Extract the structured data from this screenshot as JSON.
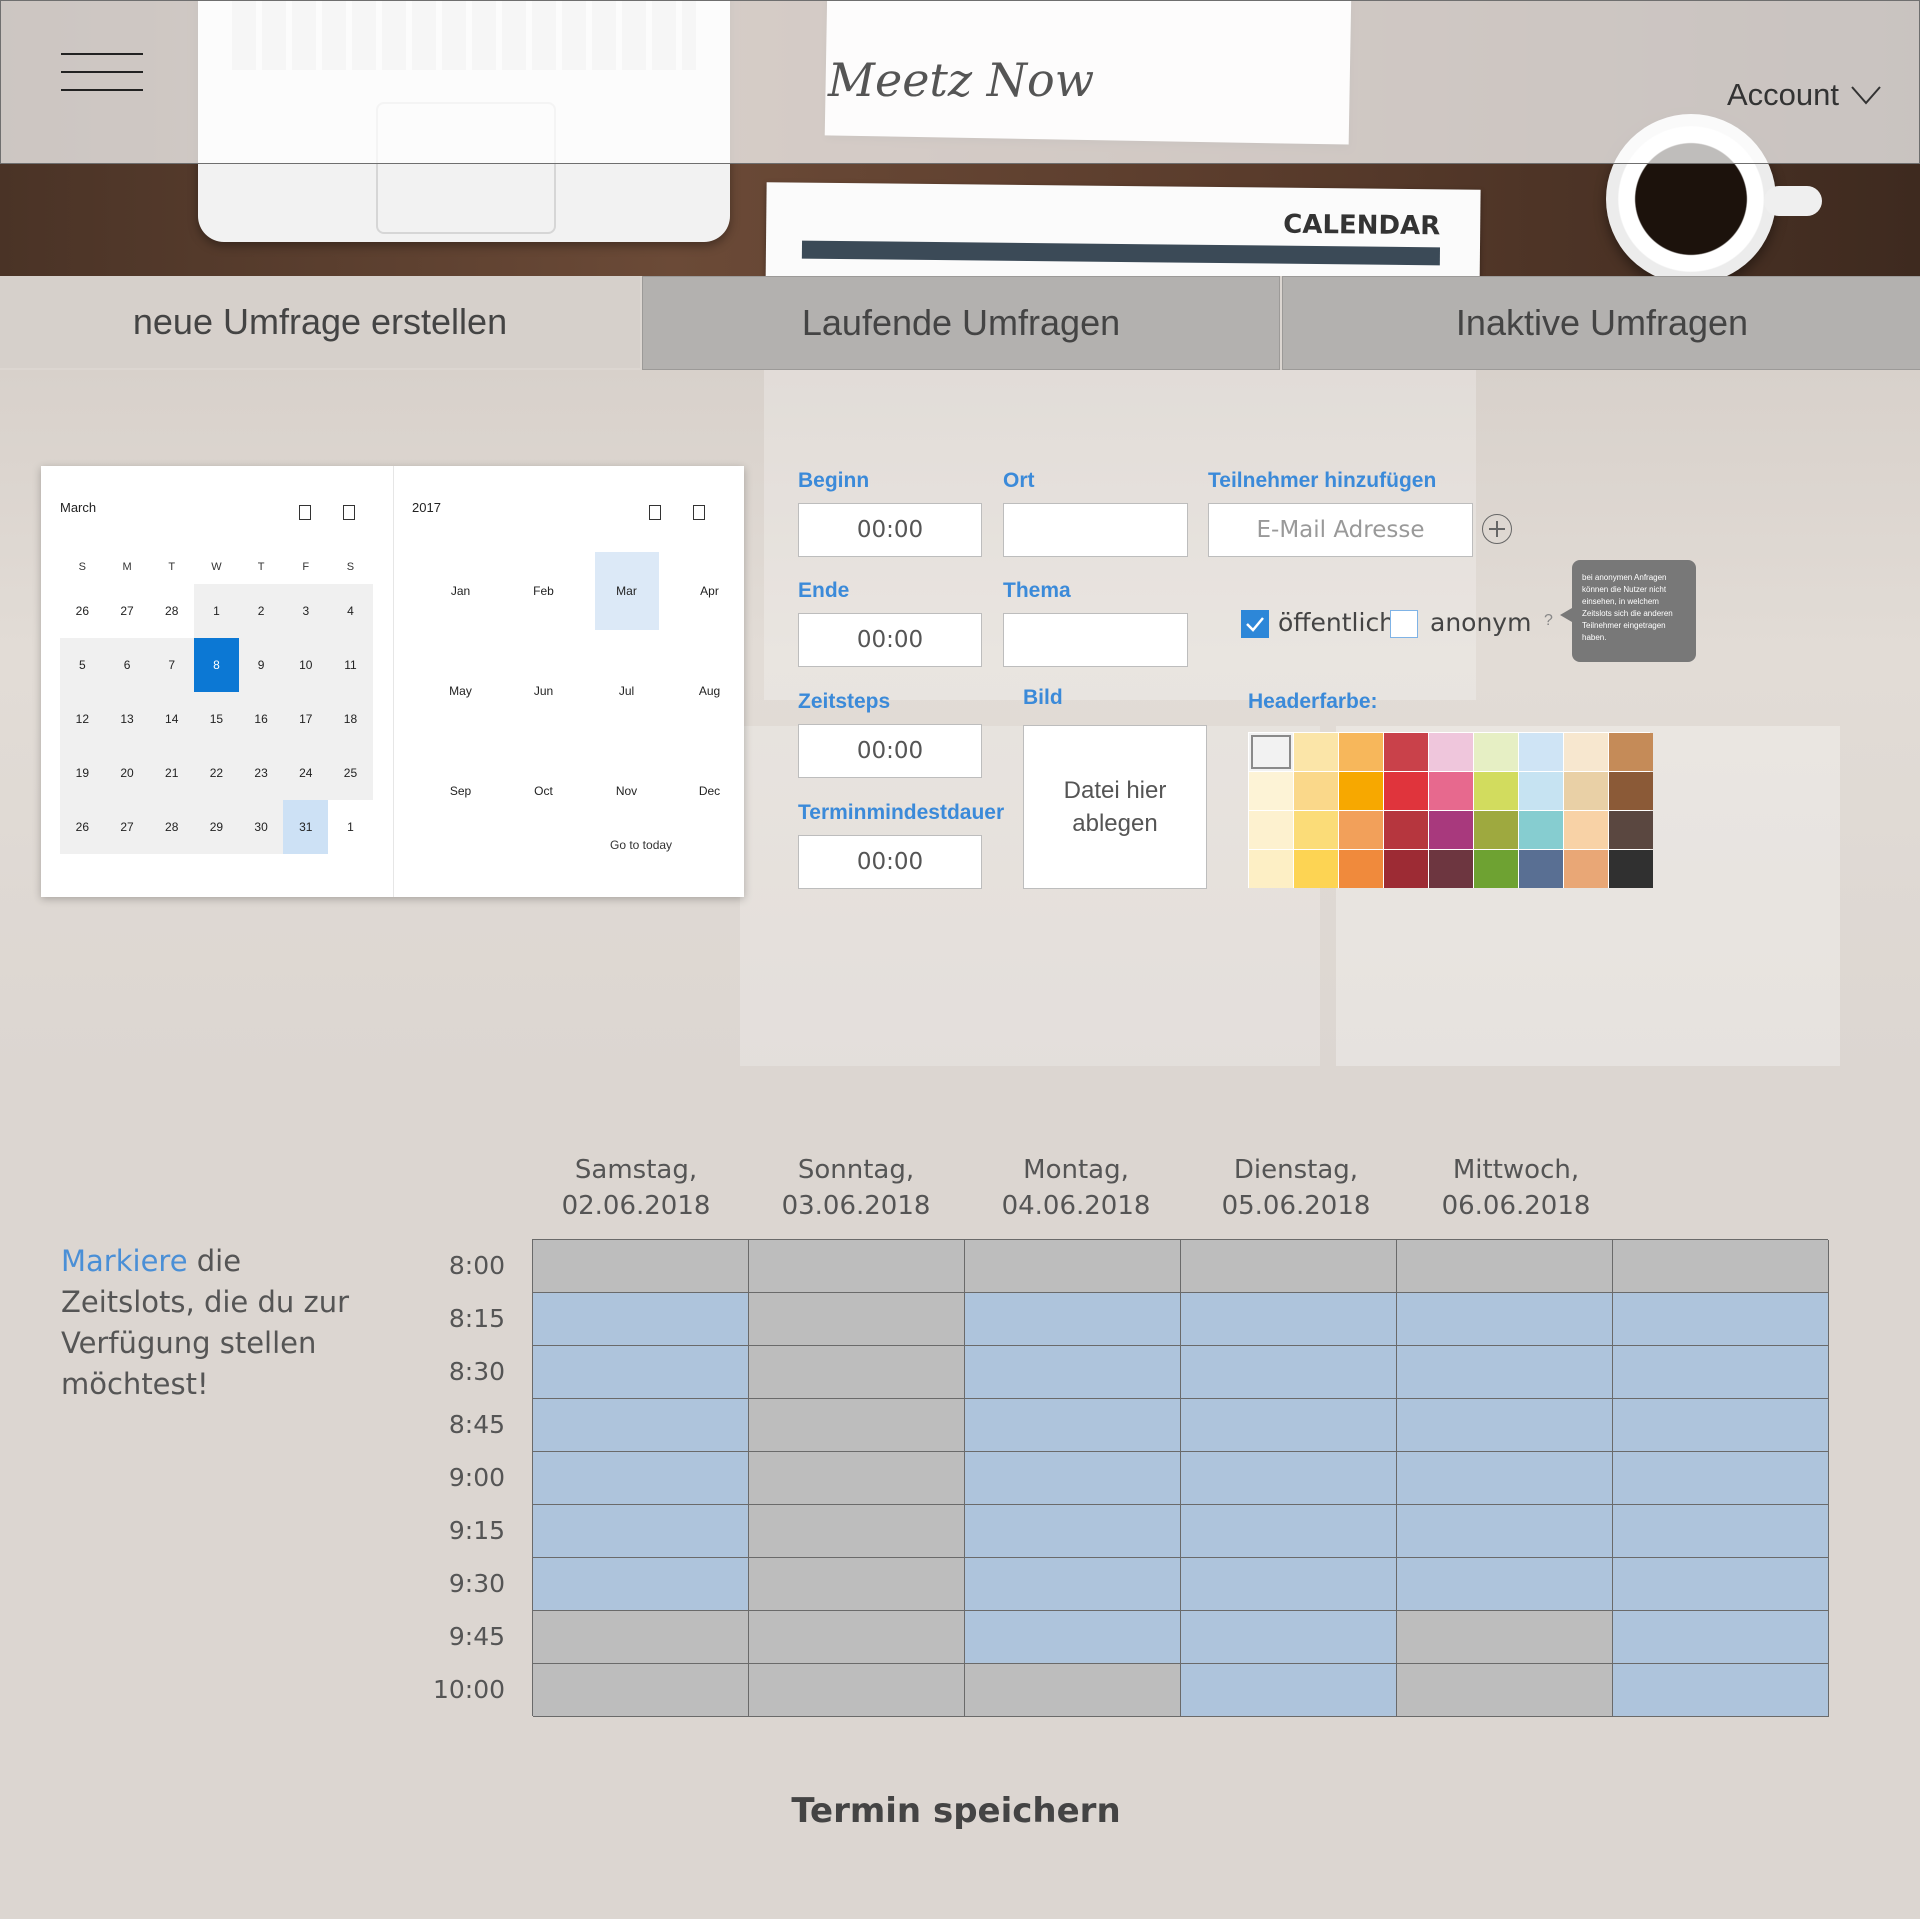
{
  "header": {
    "logo": "Meetz Now",
    "account_label": "Account",
    "menu_icon": "hamburger-icon",
    "account_icon": "chevron-down-icon",
    "background_text": "CALENDAR"
  },
  "tabs": [
    {
      "label": "neue Umfrage erstellen",
      "active": true
    },
    {
      "label": "Laufende Umfragen",
      "active": false
    },
    {
      "label": "Inaktive Umfragen",
      "active": false
    }
  ],
  "datepicker": {
    "month_label": "March",
    "year_label": "2017",
    "weekdays": [
      "S",
      "M",
      "T",
      "W",
      "T",
      "F",
      "S"
    ],
    "weeks": [
      [
        "26",
        "27",
        "28",
        "1",
        "2",
        "3",
        "4"
      ],
      [
        "5",
        "6",
        "7",
        "8",
        "9",
        "10",
        "11"
      ],
      [
        "12",
        "13",
        "14",
        "15",
        "16",
        "17",
        "18"
      ],
      [
        "19",
        "20",
        "21",
        "22",
        "23",
        "24",
        "25"
      ],
      [
        "26",
        "27",
        "28",
        "29",
        "30",
        "31",
        "1"
      ]
    ],
    "selected_day": "8",
    "months": [
      "Jan",
      "Feb",
      "Mar",
      "Apr",
      "May",
      "Jun",
      "Jul",
      "Aug",
      "Sep",
      "Oct",
      "Nov",
      "Dec"
    ],
    "current_month": "Mar",
    "go_to_today": "Go to today"
  },
  "form": {
    "beginn": {
      "label": "Beginn",
      "value": "00:00"
    },
    "ende": {
      "label": "Ende",
      "value": "00:00"
    },
    "zeitsteps": {
      "label": "Zeitsteps",
      "value": "00:00"
    },
    "terminmindestdauer": {
      "label": "Terminmindestdauer",
      "value": "00:00"
    },
    "ort": {
      "label": "Ort",
      "value": ""
    },
    "thema": {
      "label": "Thema",
      "value": ""
    },
    "bild": {
      "label": "Bild",
      "dropzone_text": "Datei hier ablegen"
    },
    "teilnehmer": {
      "label": "Teilnehmer hinzufügen",
      "placeholder": "E-Mail Adresse"
    },
    "oeffentlich": {
      "label": "öffentlich",
      "checked": true
    },
    "anonym": {
      "label": "anonym",
      "checked": false
    },
    "help": "?",
    "tooltip": "bei anonymen Anfragen können die Nutzer nicht einsehen, in welchem Zeitslots sich die anderen Teilnehmer eingetragen haben.",
    "headerfarbe_label": "Headerfarbe:",
    "palette": [
      [
        "#f2f2f2",
        "#fbe5a8",
        "#f7b75b",
        "#c9414a",
        "#efc6dc",
        "#e6efc4",
        "#cfe4f5",
        "#f7e7cf",
        "#c58b58"
      ],
      [
        "#fdf3d6",
        "#fad88a",
        "#f7a800",
        "#e0343c",
        "#e7698e",
        "#d2dc5e",
        "#c6e3f2",
        "#e9d0a6",
        "#8b5a37"
      ],
      [
        "#fdf1cf",
        "#fbdc78",
        "#f2a05a",
        "#b6363e",
        "#a8397d",
        "#9ea93f",
        "#86cdd0",
        "#f8d2a6",
        "#5a4740"
      ],
      [
        "#fdefc5",
        "#fdd453",
        "#f08a3c",
        "#9d2b34",
        "#6d3640",
        "#6ea232",
        "#596f93",
        "#e9a776",
        "#303030"
      ]
    ],
    "selected_color": "#f2f2f2"
  },
  "schedule": {
    "instruction_highlight": "Markiere",
    "instruction_rest": " die Zeitslots, die du zur Verfügung stellen möchtest!",
    "days": [
      {
        "weekday": "Samstag,",
        "date": "02.06.2018"
      },
      {
        "weekday": "Sonntag,",
        "date": "03.06.2018"
      },
      {
        "weekday": "Montag,",
        "date": "04.06.2018"
      },
      {
        "weekday": "Dienstag,",
        "date": "05.06.2018"
      },
      {
        "weekday": "Mittwoch,",
        "date": "06.06.2018"
      }
    ],
    "times": [
      "8:00",
      "8:15",
      "8:30",
      "8:45",
      "9:00",
      "9:15",
      "9:30",
      "9:45",
      "10:00"
    ],
    "availability": [
      [
        false,
        false,
        false,
        false,
        false,
        false
      ],
      [
        true,
        false,
        true,
        true,
        true,
        true
      ],
      [
        true,
        false,
        true,
        true,
        true,
        true
      ],
      [
        true,
        false,
        true,
        true,
        true,
        true
      ],
      [
        true,
        false,
        true,
        true,
        true,
        true
      ],
      [
        true,
        false,
        true,
        true,
        true,
        true
      ],
      [
        true,
        false,
        true,
        true,
        true,
        true
      ],
      [
        false,
        false,
        true,
        true,
        false,
        true
      ],
      [
        false,
        false,
        false,
        true,
        false,
        true
      ]
    ],
    "available_color": "#aec4dc",
    "unavailable_color": "#bdbdbd",
    "save_label": "Termin speichern"
  }
}
